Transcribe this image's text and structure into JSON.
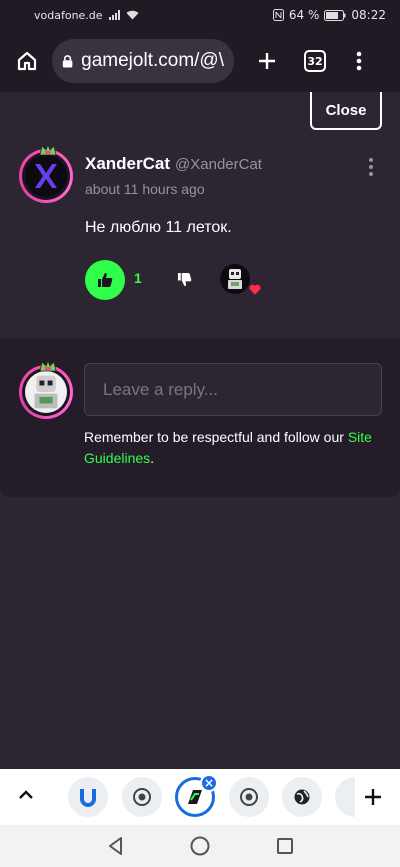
{
  "status": {
    "carrier": "vodafone.de",
    "battery": "64 %",
    "time": "08:22"
  },
  "browser": {
    "url": "gamejolt.com/@\\",
    "tab_count": "32"
  },
  "page": {
    "close_label": "Close"
  },
  "comment": {
    "author_name": "XanderCat",
    "author_handle": "@XanderCat",
    "timestamp": "about 11 hours ago",
    "text": "Не люблю 11 леток.",
    "like_count": "1"
  },
  "reply": {
    "placeholder": "Leave a reply...",
    "note_text": "Remember to be respectful and follow our",
    "guidelines_link": "Site Guidelines",
    "note_end": "."
  },
  "colors": {
    "accent_green": "#2fff4a",
    "background": "#2e2533",
    "avatar_ring": "#ff4fb0"
  },
  "icons": {
    "home": "home-icon",
    "lock": "lock-icon",
    "new_tab": "plus-icon",
    "menu": "kebab-menu-icon",
    "thumbs_up": "thumbs-up-icon",
    "thumbs_down": "thumbs-down-icon",
    "heart": "heart-icon"
  }
}
